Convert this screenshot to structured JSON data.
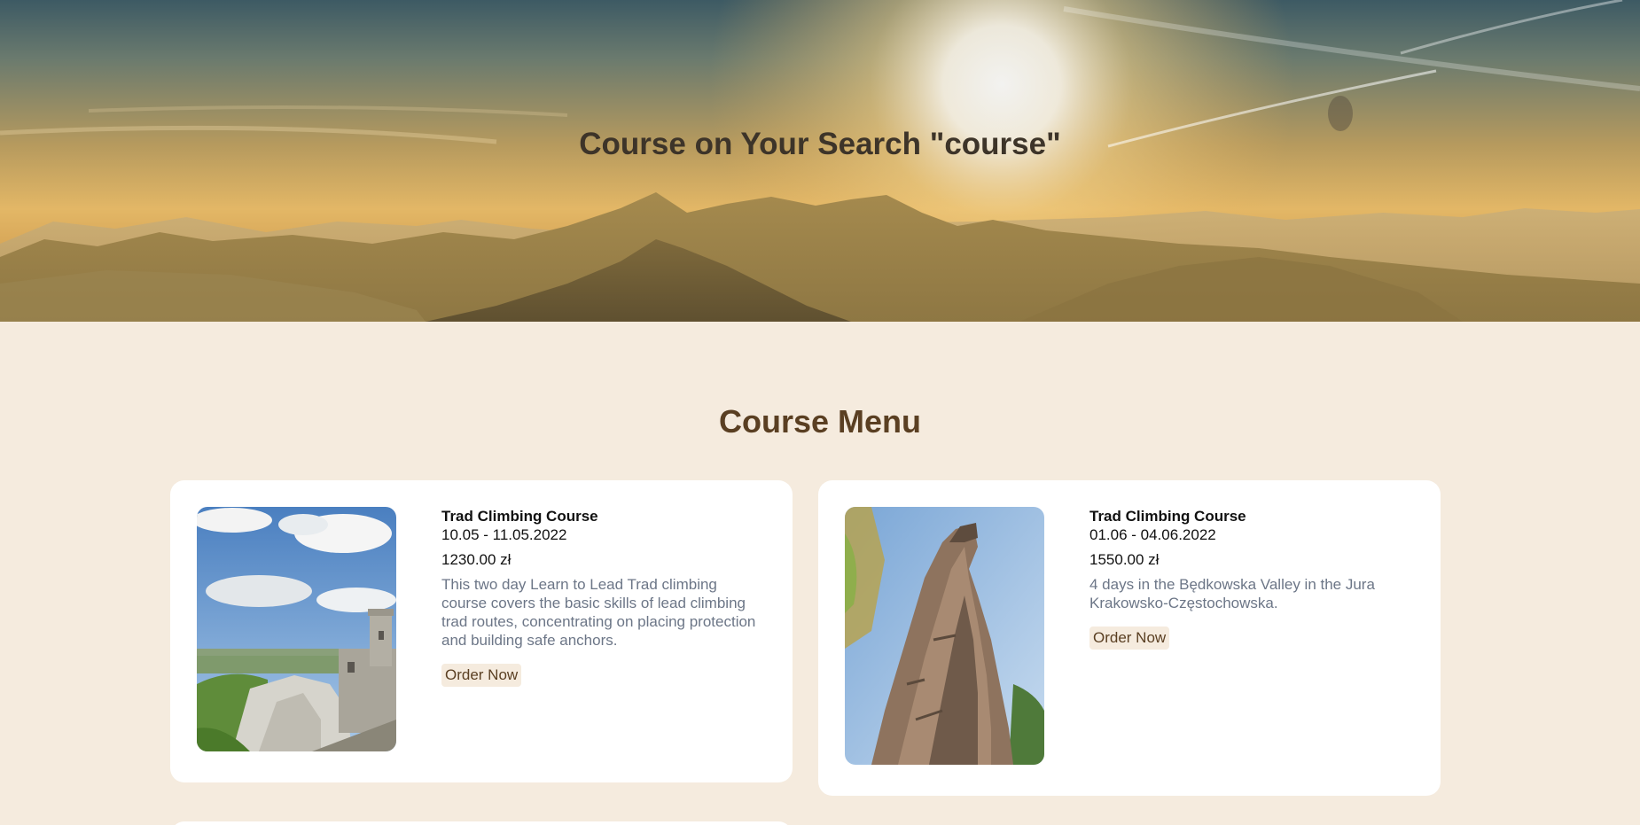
{
  "hero": {
    "title": "Course on Your Search \"course\""
  },
  "section": {
    "title": "Course Menu"
  },
  "courses": [
    {
      "title": "Trad Climbing Course",
      "dates": "10.05 - 11.05.2022",
      "price": "1230.00 zł",
      "description": "This two day Learn to Lead Trad climbing course covers the basic skills of lead climbing trad routes, concentrating on placing protection and building safe anchors.",
      "order_label": "Order Now"
    },
    {
      "title": "Trad Climbing Course",
      "dates": "01.06 - 04.06.2022",
      "price": "1550.00 zł",
      "description": "4 days in the Będkowska Valley in the Jura Krakowsko-Częstochowska.",
      "order_label": "Order Now"
    }
  ],
  "colors": {
    "page_background": "#f5ebde",
    "heading": "#5a3f22",
    "description_text": "#6c7687",
    "card_background": "#ffffff"
  }
}
